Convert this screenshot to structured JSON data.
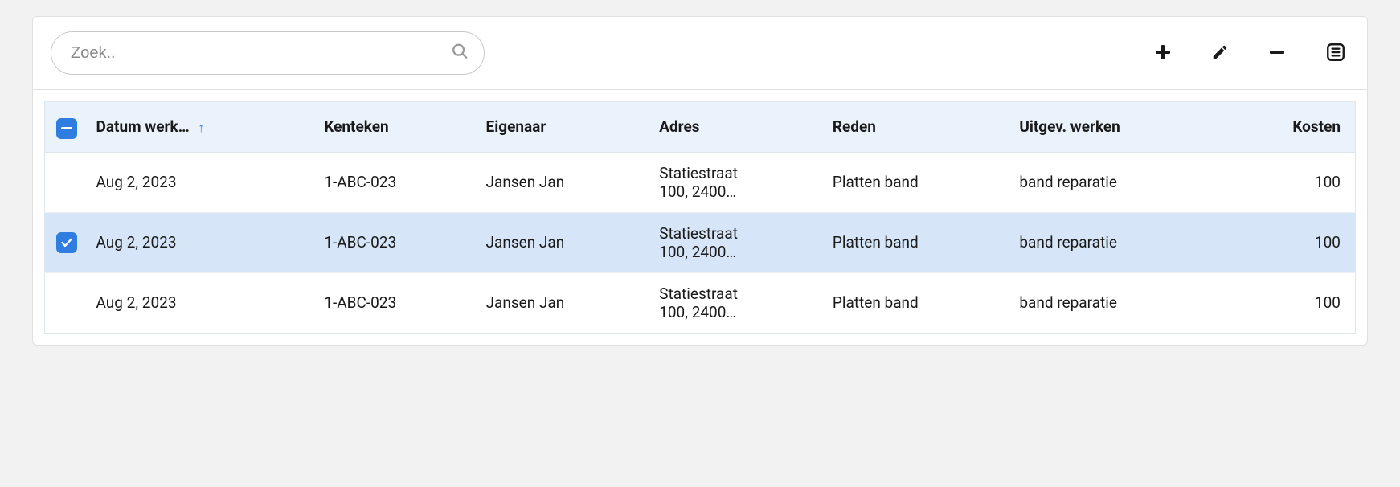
{
  "search": {
    "placeholder": "Zoek.."
  },
  "columns": {
    "datum": "Datum werk…",
    "kenteken": "Kenteken",
    "eigenaar": "Eigenaar",
    "adres": "Adres",
    "reden": "Reden",
    "werken": "Uitgev. werken",
    "kosten": "Kosten"
  },
  "sort": {
    "column": "datum",
    "dir": "asc",
    "arrow": "↑"
  },
  "header_check_state": "indeterminate",
  "rows": [
    {
      "selected": false,
      "datum": "Aug 2, 2023",
      "kenteken": "1-ABC-023",
      "eigenaar": "Jansen Jan",
      "adres_line1": "Statiestraat",
      "adres_line2": "100, 2400…",
      "reden": "Platten band",
      "werken": "band reparatie",
      "kosten": "100"
    },
    {
      "selected": true,
      "datum": "Aug 2, 2023",
      "kenteken": "1-ABC-023",
      "eigenaar": "Jansen Jan",
      "adres_line1": "Statiestraat",
      "adres_line2": "100, 2400…",
      "reden": "Platten band",
      "werken": "band reparatie",
      "kosten": "100"
    },
    {
      "selected": false,
      "datum": "Aug 2, 2023",
      "kenteken": "1-ABC-023",
      "eigenaar": "Jansen Jan",
      "adres_line1": "Statiestraat",
      "adres_line2": "100, 2400…",
      "reden": "Platten band",
      "werken": "band reparatie",
      "kosten": "100"
    }
  ]
}
